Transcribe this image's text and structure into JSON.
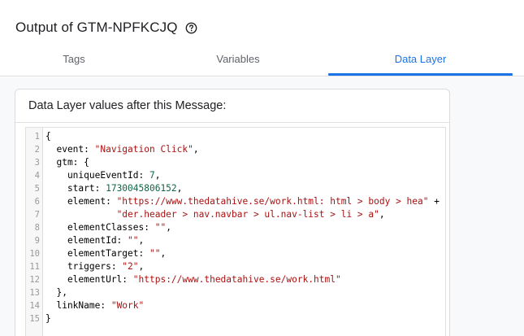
{
  "header": {
    "title": "Output of GTM-NPFKCJQ",
    "help_icon": "help-circle-icon"
  },
  "tabs": [
    {
      "label": "Tags",
      "active": false
    },
    {
      "label": "Variables",
      "active": false
    },
    {
      "label": "Data Layer",
      "active": true
    }
  ],
  "colors": {
    "accent": "#1a73e8",
    "string": "#aa1111",
    "number": "#116644",
    "gutter_text": "#999999"
  },
  "card": {
    "title": "Data Layer values after this Message:"
  },
  "code": {
    "line_numbers": [
      "1",
      "2",
      "3",
      "4",
      "5",
      "6",
      "7",
      "8",
      "9",
      "10",
      "11",
      "12",
      "13",
      "14",
      "15"
    ],
    "lines": [
      {
        "text": "{"
      },
      {
        "key": "  event: ",
        "val": "\"Navigation Click\"",
        "vtype": "str",
        "tail": ","
      },
      {
        "key": "  gtm: ",
        "tail": "{"
      },
      {
        "key": "    uniqueEventId: ",
        "val": "7",
        "vtype": "num",
        "tail": ","
      },
      {
        "key": "    start: ",
        "val": "1730045806152",
        "vtype": "num",
        "tail": ","
      },
      {
        "key": "    element: ",
        "val": "\"https://www.thedatahive.se/work.html: html > body > hea\"",
        "vtype": "str",
        "tail": " +"
      },
      {
        "key": "             ",
        "val": "\"der.header > nav.navbar > ul.nav-list > li > a\"",
        "vtype": "str",
        "tail": ","
      },
      {
        "key": "    elementClasses: ",
        "val": "\"\"",
        "vtype": "str",
        "tail": ","
      },
      {
        "key": "    elementId: ",
        "val": "\"\"",
        "vtype": "str",
        "tail": ","
      },
      {
        "key": "    elementTarget: ",
        "val": "\"\"",
        "vtype": "str",
        "tail": ","
      },
      {
        "key": "    triggers: ",
        "val": "\"2\"",
        "vtype": "str",
        "tail": ","
      },
      {
        "key": "    elementUrl: ",
        "val": "\"https://www.thedatahive.se/work.html\"",
        "vtype": "str",
        "tail": ""
      },
      {
        "text": "  },"
      },
      {
        "key": "  linkName: ",
        "val": "\"Work\"",
        "vtype": "str",
        "tail": ""
      },
      {
        "text": "}"
      }
    ]
  }
}
